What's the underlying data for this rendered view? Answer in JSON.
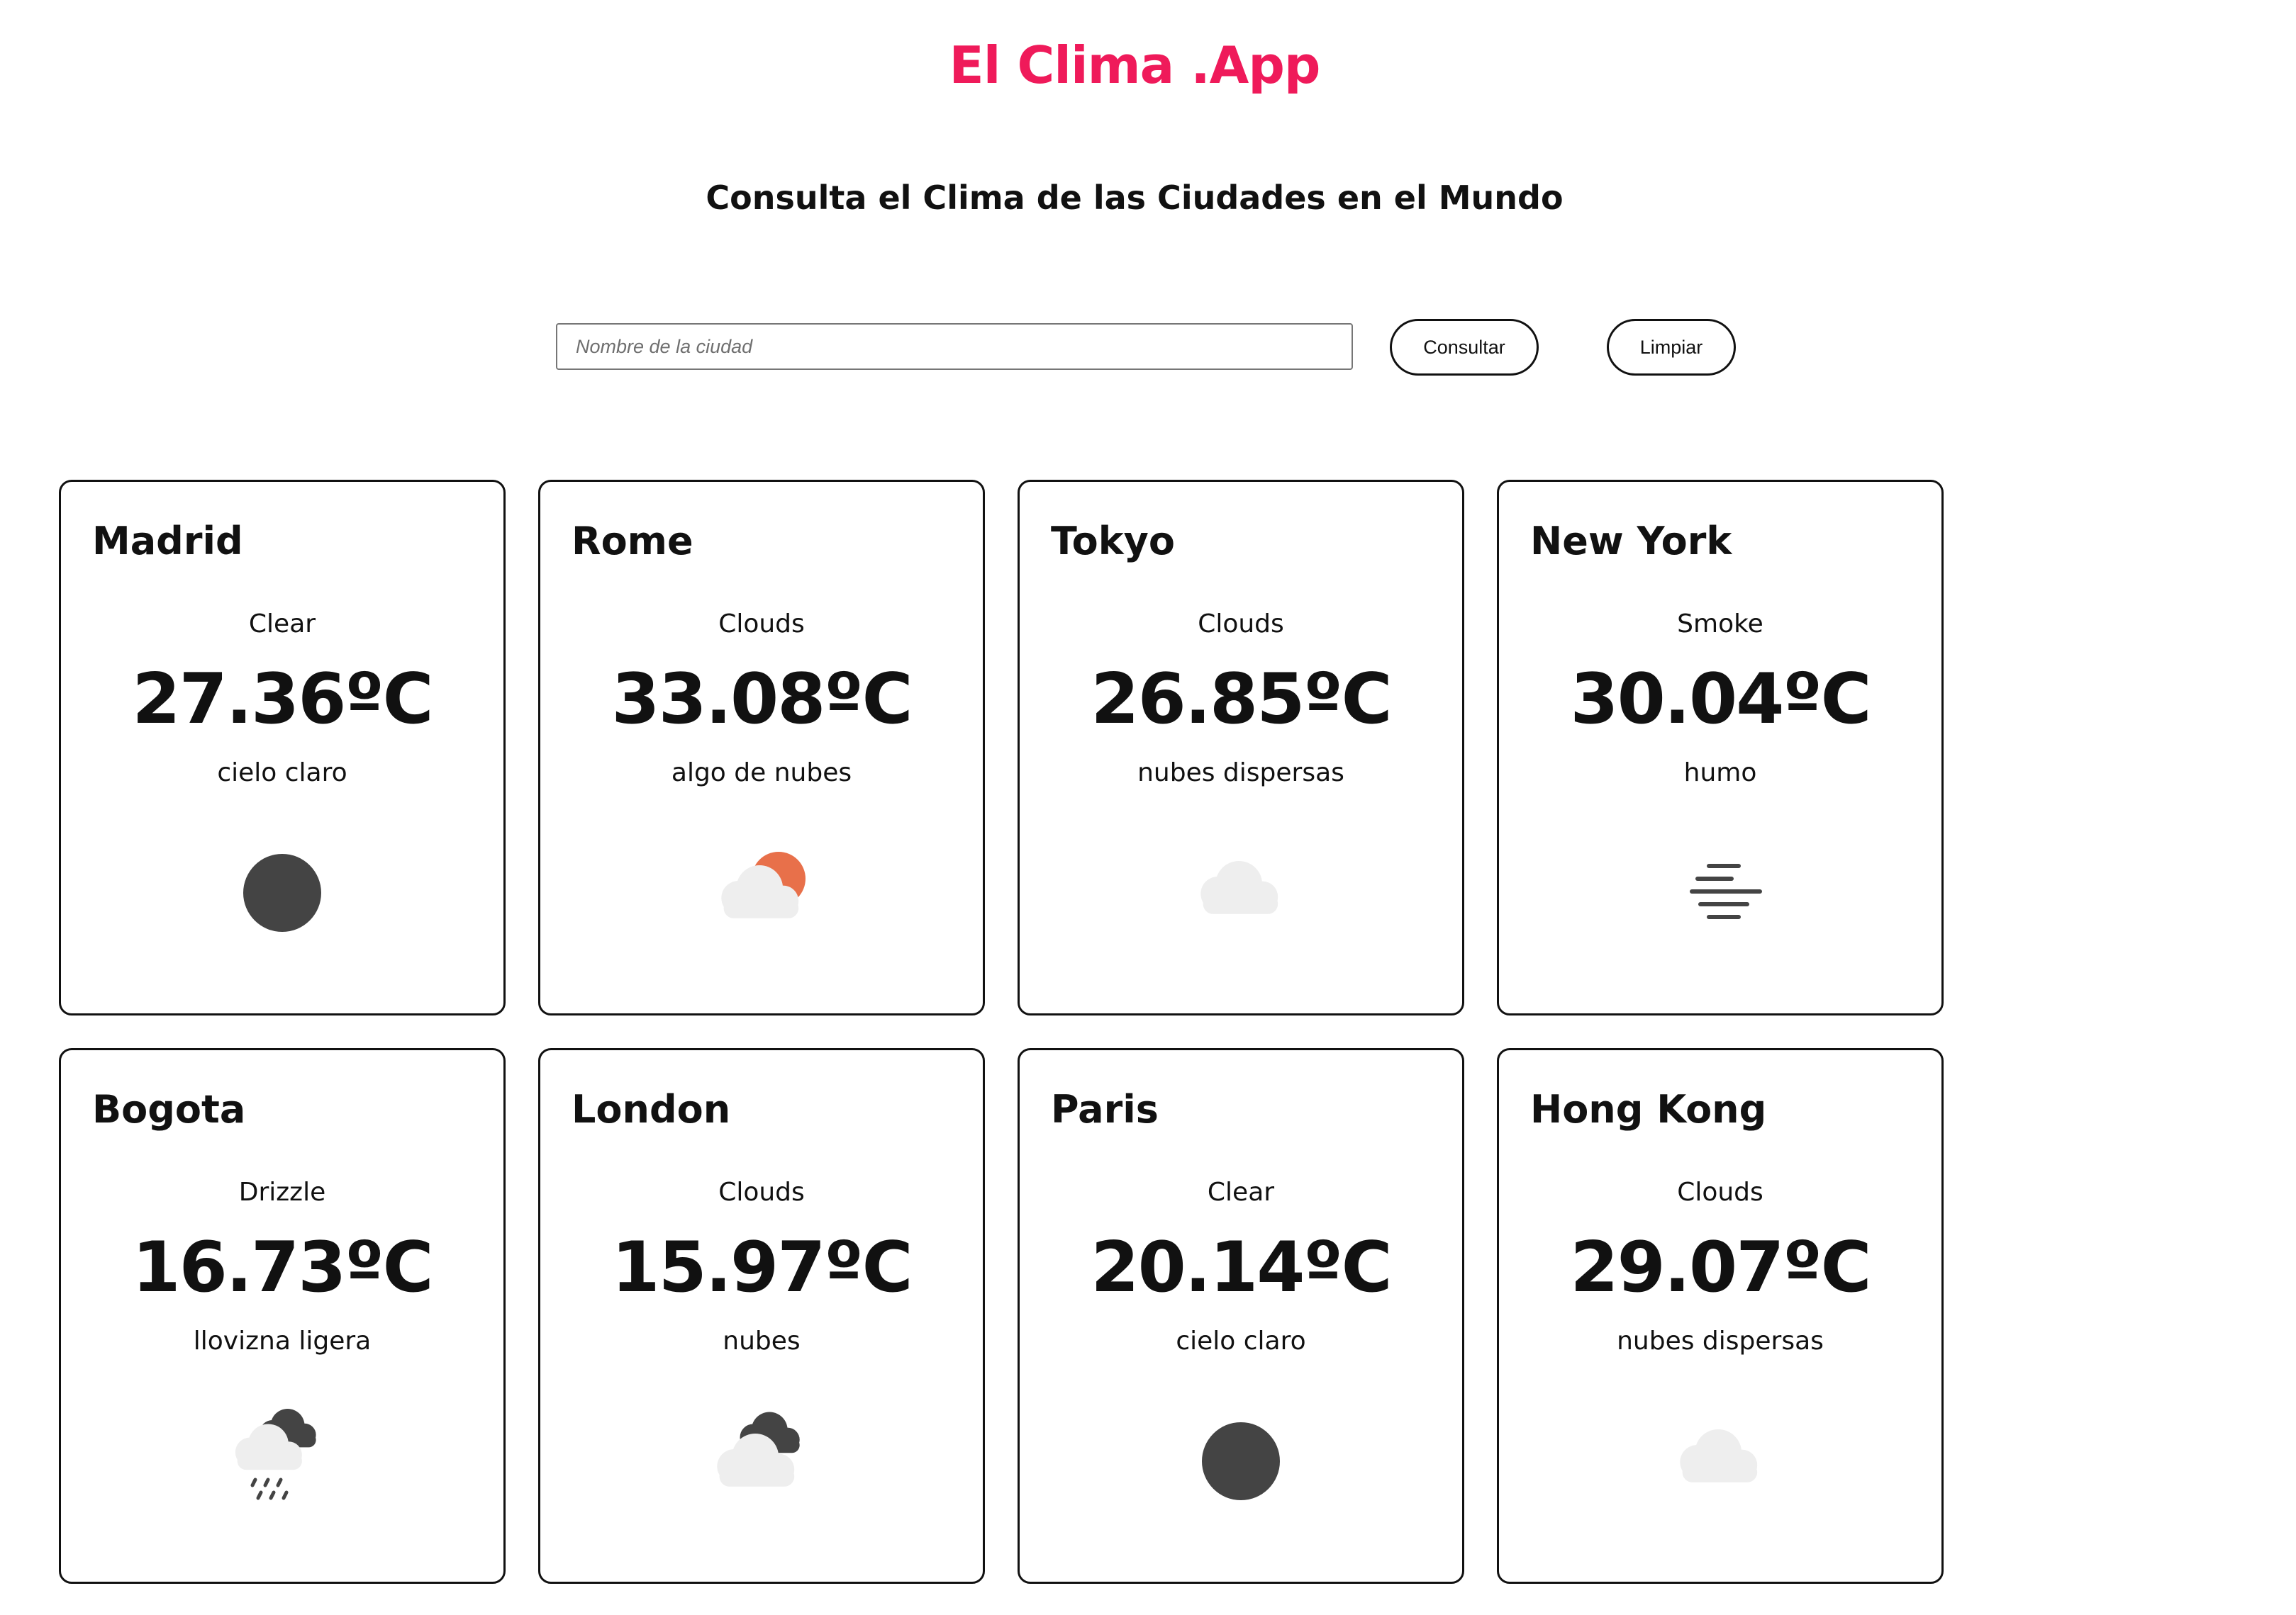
{
  "app": {
    "title": "El Clima .App",
    "subtitle": "Consulta el Clima de las Ciudades en el Mundo"
  },
  "search": {
    "placeholder": "Nombre de la ciudad",
    "value": "",
    "consultar_label": "Consultar",
    "limpiar_label": "Limpiar"
  },
  "colors": {
    "brand": "#ef1a5a",
    "sun_dark": "#444444",
    "sun_orange": "#e8704a",
    "cloud_light": "#eeeeee",
    "cloud_dark": "#444444"
  },
  "cards": [
    {
      "city": "Madrid",
      "main": "Clear",
      "temp": "27.36ºC",
      "description": "cielo claro",
      "icon": "clear-sky-icon"
    },
    {
      "city": "Rome",
      "main": "Clouds",
      "temp": "33.08ºC",
      "description": "algo de nubes",
      "icon": "few-clouds-icon"
    },
    {
      "city": "Tokyo",
      "main": "Clouds",
      "temp": "26.85ºC",
      "description": "nubes dispersas",
      "icon": "scattered-clouds-icon"
    },
    {
      "city": "New York",
      "main": "Smoke",
      "temp": "30.04ºC",
      "description": "humo",
      "icon": "smoke-icon"
    },
    {
      "city": "Bogota",
      "main": "Drizzle",
      "temp": "16.73ºC",
      "description": "llovizna ligera",
      "icon": "drizzle-icon"
    },
    {
      "city": "London",
      "main": "Clouds",
      "temp": "15.97ºC",
      "description": "nubes",
      "icon": "broken-clouds-icon"
    },
    {
      "city": "Paris",
      "main": "Clear",
      "temp": "20.14ºC",
      "description": "cielo claro",
      "icon": "clear-sky-icon"
    },
    {
      "city": "Hong Kong",
      "main": "Clouds",
      "temp": "29.07ºC",
      "description": "nubes dispersas",
      "icon": "scattered-clouds-icon"
    }
  ]
}
